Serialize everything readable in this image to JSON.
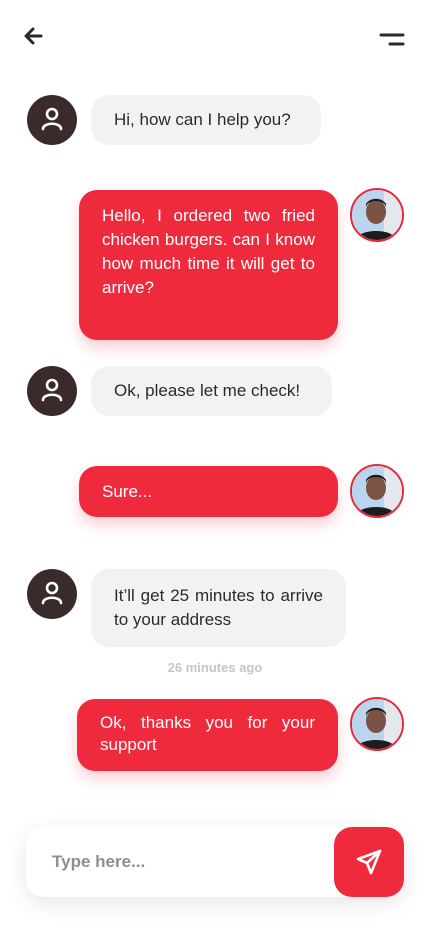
{
  "header": {
    "back_icon": "arrow-left-icon",
    "menu_icon": "menu-icon"
  },
  "messages": [
    {
      "sender": "agent",
      "text": "Hi, how can I help you?"
    },
    {
      "sender": "user",
      "text": "Hello, I ordered two fried chicken burgers. can I know how much time it will get to arrive?"
    },
    {
      "sender": "agent",
      "text": "Ok, please let me check!"
    },
    {
      "sender": "user",
      "text": "Sure..."
    },
    {
      "sender": "agent",
      "text": "It’ll get 25 minutes to arrive to your address"
    },
    {
      "sender": "user",
      "text": "Ok, thanks you for your support"
    }
  ],
  "timestamp": "26 minutes ago",
  "composer": {
    "placeholder": "Type here...",
    "send_icon": "send-icon"
  },
  "colors": {
    "accent": "#ef2a3c",
    "agent_bubble": "#f1f2f4",
    "agent_avatar": "#3a2a2c"
  }
}
